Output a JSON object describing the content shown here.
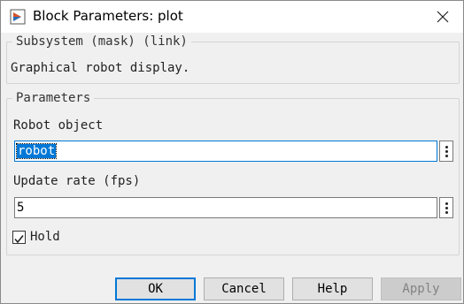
{
  "window": {
    "title": "Block Parameters: plot",
    "app_icon": "simulink-block-icon",
    "close_icon": "close-icon"
  },
  "subsystem_group": {
    "legend": "Subsystem (mask) (link)",
    "description": "Graphical robot display."
  },
  "parameters_group": {
    "legend": "Parameters",
    "robot_object": {
      "label": "Robot object",
      "value": "robot",
      "selected": true
    },
    "update_rate": {
      "label": "Update rate (fps)",
      "value": "5"
    },
    "hold": {
      "label": "Hold",
      "checked": true
    }
  },
  "buttons": {
    "ok": "OK",
    "cancel": "Cancel",
    "help": "Help",
    "apply": "Apply"
  },
  "colors": {
    "accent": "#0078d7",
    "disabled_text": "#838383"
  }
}
